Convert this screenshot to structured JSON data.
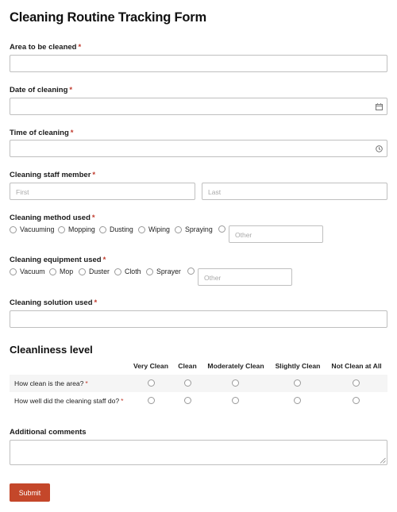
{
  "form": {
    "title": "Cleaning Routine Tracking Form",
    "required_mark": "*",
    "area": {
      "label": "Area to be cleaned"
    },
    "date": {
      "label": "Date of cleaning",
      "icon": "calendar-icon"
    },
    "time": {
      "label": "Time of cleaning",
      "icon": "clock-icon"
    },
    "staff": {
      "label": "Cleaning staff member",
      "first_placeholder": "First",
      "last_placeholder": "Last"
    },
    "method": {
      "label": "Cleaning method used",
      "options": [
        "Vacuuming",
        "Mopping",
        "Dusting",
        "Wiping",
        "Spraying"
      ],
      "other_placeholder": "Other"
    },
    "equipment": {
      "label": "Cleaning equipment used",
      "options": [
        "Vacuum",
        "Mop",
        "Duster",
        "Cloth",
        "Sprayer"
      ],
      "other_placeholder": "Other"
    },
    "solution": {
      "label": "Cleaning solution used"
    },
    "cleanliness": {
      "heading": "Cleanliness level",
      "columns": [
        "Very Clean",
        "Clean",
        "Moderately Clean",
        "Slightly Clean",
        "Not Clean at All"
      ],
      "rows": [
        "How clean is the area?",
        "How well did the cleaning staff do?"
      ]
    },
    "comments": {
      "label": "Additional comments"
    },
    "submit_label": "Submit",
    "colors": {
      "accent": "#c4472a",
      "required": "#c0392b",
      "border": "#bfbfbf"
    }
  }
}
